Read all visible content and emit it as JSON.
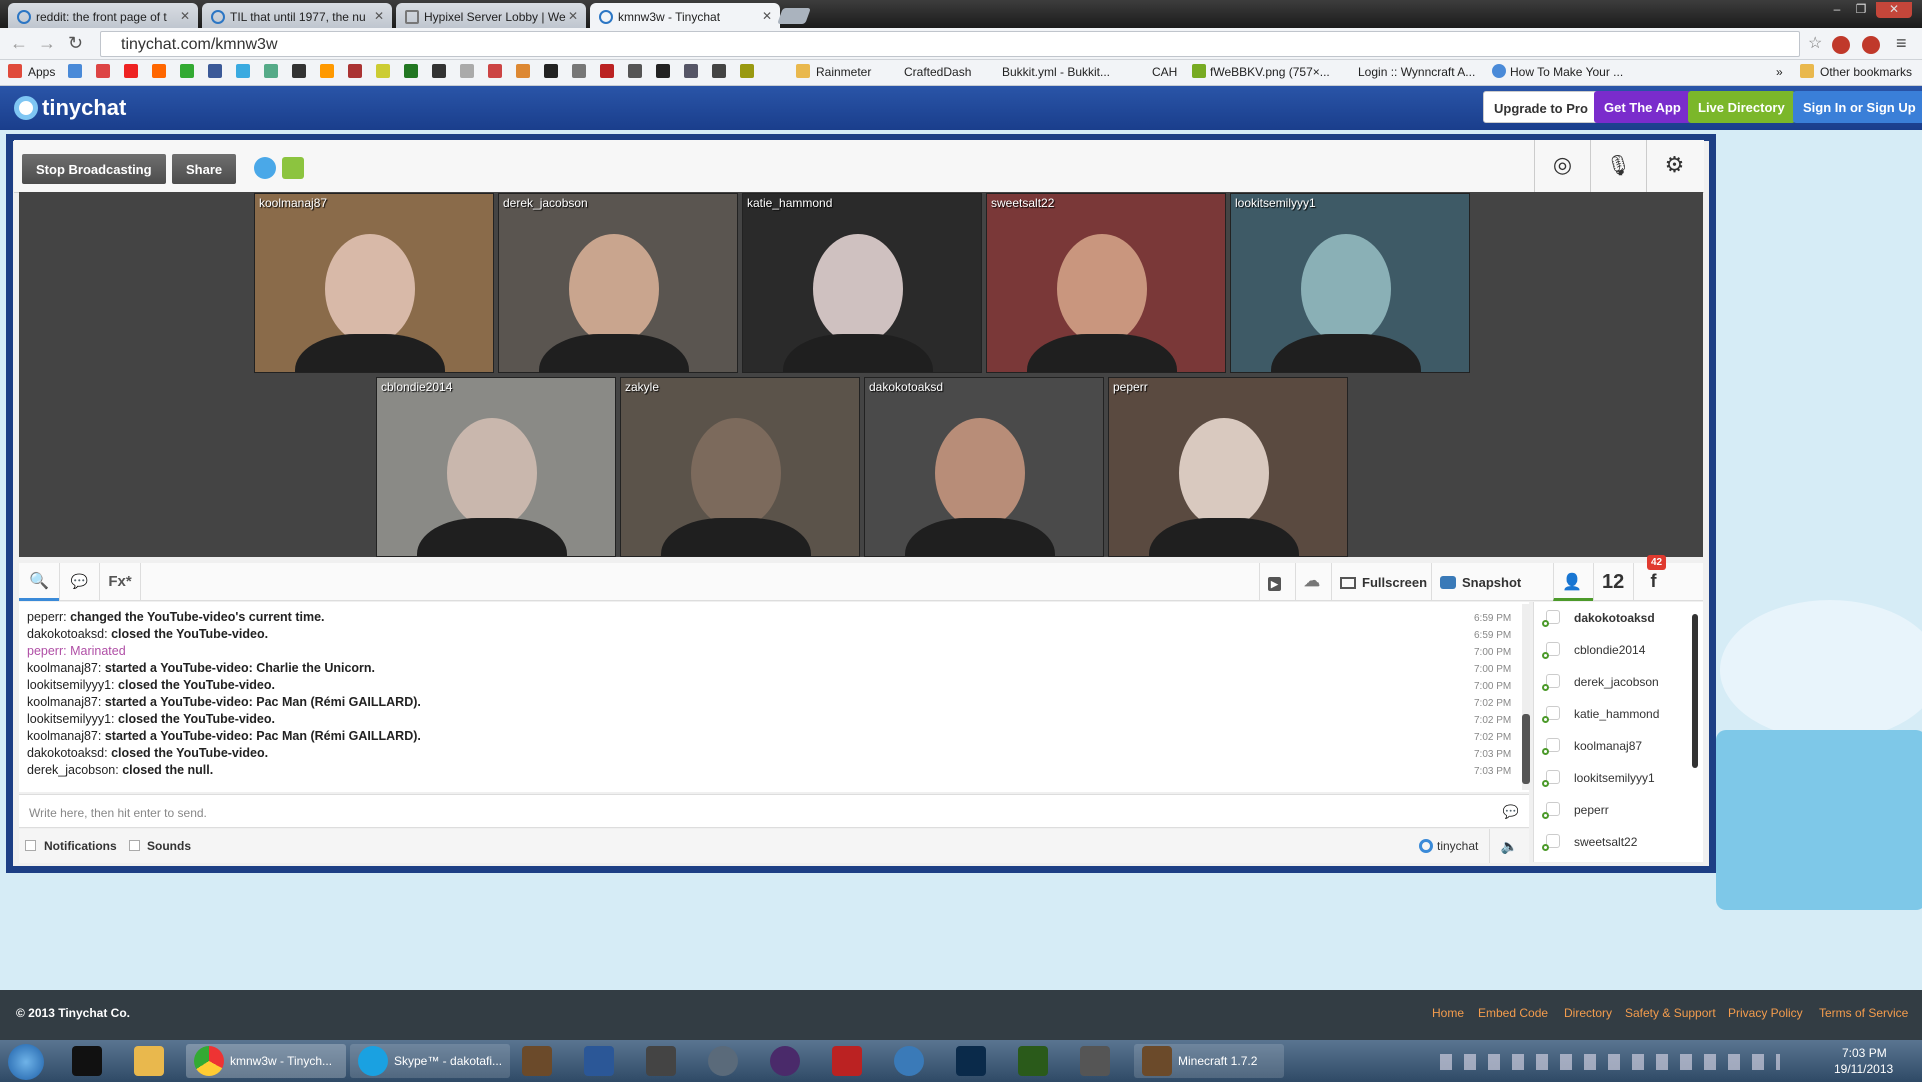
{
  "browser": {
    "tabs": [
      {
        "title": "reddit: the front page of t"
      },
      {
        "title": "TIL that until 1977, the nu"
      },
      {
        "title": "Hypixel Server Lobby | We"
      },
      {
        "title": "kmnw3w - Tinychat"
      }
    ],
    "url": "tinychat.com/kmnw3w",
    "bookmarks": [
      "Apps",
      "Rainmeter",
      "CraftedDash",
      "Bukkit.yml - Bukkit...",
      "CAH",
      "fWeBBKV.png (757×...",
      "Login :: Wynncraft A...",
      "How To Make Your ...",
      "»",
      "Other bookmarks"
    ]
  },
  "header": {
    "brand": "tinychat",
    "buttons": [
      "Upgrade to Pro",
      "Get The App",
      "Live Directory",
      "Sign In or Sign Up"
    ]
  },
  "toolbar": {
    "stop_broadcasting": "Stop Broadcasting",
    "share": "Share"
  },
  "cams": [
    {
      "name": "koolmanaj87",
      "bg": "#8a6b4a",
      "face": "#d8b9a8"
    },
    {
      "name": "derek_jacobson",
      "bg": "#5a5550",
      "face": "#c9a58e"
    },
    {
      "name": "katie_hammond",
      "bg": "#2a2a2a",
      "face": "#cfc1c0"
    },
    {
      "name": "sweetsalt22",
      "bg": "#7a3838",
      "face": "#c9967e"
    },
    {
      "name": "lookitsemilyyy1",
      "bg": "#3e5a66",
      "face": "#8ab0b6"
    },
    {
      "name": "cblondie2014",
      "bg": "#8a8a86",
      "face": "#c9b7ad"
    },
    {
      "name": "zakyle",
      "bg": "#5b534a",
      "face": "#7c6a5c"
    },
    {
      "name": "dakokotoaksd",
      "bg": "#4a4a4a",
      "face": "#b88d78"
    },
    {
      "name": "peperr",
      "bg": "#5a4a40",
      "face": "#d9c9bf"
    }
  ],
  "mediabar": {
    "fullscreen": "Fullscreen",
    "snapshot": "Snapshot",
    "user_count": "12",
    "fb_badge": "42",
    "fx": "Fx*"
  },
  "chat": [
    {
      "user": "peperr:",
      "msg": "changed the YouTube-video's current time.",
      "time": "6:59 PM",
      "bold": true,
      "color": "#222"
    },
    {
      "user": "dakokotoaksd:",
      "msg": "closed the YouTube-video.",
      "time": "6:59 PM",
      "bold": true,
      "color": "#222"
    },
    {
      "user": "peperr:",
      "msg": "Marinated",
      "time": "7:00 PM",
      "bold": false,
      "color": "#b04fa6"
    },
    {
      "user": "koolmanaj87:",
      "msg": "started a YouTube-video: Charlie the Unicorn.",
      "time": "7:00 PM",
      "bold": true,
      "color": "#222"
    },
    {
      "user": "lookitsemilyyy1:",
      "msg": "closed the YouTube-video.",
      "time": "7:00 PM",
      "bold": true,
      "color": "#222"
    },
    {
      "user": "koolmanaj87:",
      "msg": "started a YouTube-video: Pac Man (Rémi GAILLARD).",
      "time": "7:02 PM",
      "bold": true,
      "color": "#222"
    },
    {
      "user": "lookitsemilyyy1:",
      "msg": "closed the YouTube-video.",
      "time": "7:02 PM",
      "bold": true,
      "color": "#222"
    },
    {
      "user": "koolmanaj87:",
      "msg": "started a YouTube-video: Pac Man (Rémi GAILLARD).",
      "time": "7:02 PM",
      "bold": true,
      "color": "#222"
    },
    {
      "user": "dakokotoaksd:",
      "msg": "closed the YouTube-video.",
      "time": "7:03 PM",
      "bold": true,
      "color": "#222"
    },
    {
      "user": "derek_jacobson:",
      "msg": "closed the null.",
      "time": "7:03 PM",
      "bold": true,
      "color": "#222"
    }
  ],
  "chat_input_placeholder": "Write here, then hit enter to send.",
  "footer_options": {
    "notifications": "Notifications",
    "sounds": "Sounds",
    "brand": "tinychat"
  },
  "users": [
    "dakokotoaksd",
    "cblondie2014",
    "derek_jacobson",
    "katie_hammond",
    "koolmanaj87",
    "lookitsemilyyy1",
    "peperr",
    "sweetsalt22"
  ],
  "page_footer": {
    "copyright": "© 2013 Tinychat Co.",
    "links": [
      "Home",
      "Embed Code",
      "Directory",
      "Safety & Support",
      "Privacy Policy",
      "Terms of Service"
    ]
  },
  "taskbar": {
    "items": [
      "kmnw3w - Tinych...",
      "Skype™ - dakotafi...",
      "Minecraft 1.7.2"
    ],
    "time": "7:03 PM",
    "date": "19/11/2013"
  }
}
